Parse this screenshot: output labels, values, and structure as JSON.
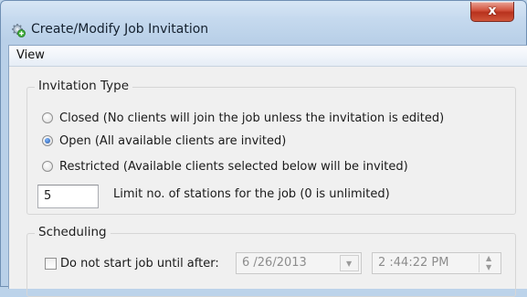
{
  "window": {
    "title": "Create/Modify Job Invitation",
    "close_label": "x",
    "icon": "gear-plus-icon"
  },
  "menu": {
    "items": [
      "View"
    ]
  },
  "invitation_type": {
    "title": "Invitation Type",
    "options": [
      {
        "label": "Closed (No clients will join the job unless the invitation is edited)",
        "checked": false
      },
      {
        "label": "Open (All available clients are invited)",
        "checked": true
      },
      {
        "label": "Restricted (Available clients selected below will be invited)",
        "checked": false
      }
    ],
    "station_limit_value": "5",
    "station_limit_label": "Limit no. of stations for the job (0 is unlimited)"
  },
  "scheduling": {
    "title": "Scheduling",
    "delay_checkbox_label": "Do not start job until after:",
    "delay_checked": false,
    "date_value": "6 /26/2013",
    "time_value": "2 :44:22 PM"
  },
  "colors": {
    "title_bar": "#c5d9ee",
    "client_bg": "#f0f0f0",
    "close_button": "#c9432c"
  }
}
